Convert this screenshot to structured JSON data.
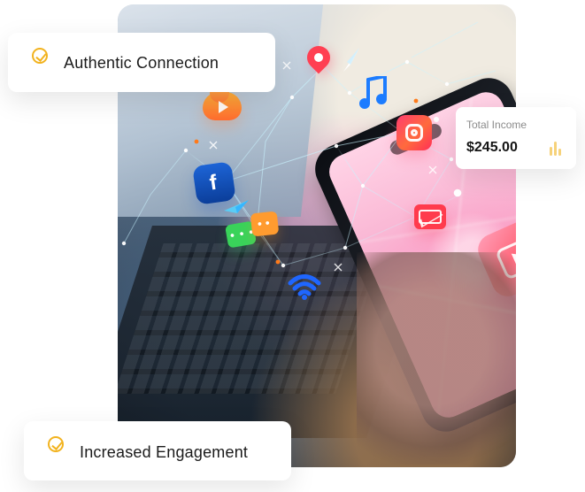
{
  "cards": {
    "authentic_connection": {
      "label": "Authentic Connection"
    },
    "increased_engagement": {
      "label": "Increased Engagement"
    }
  },
  "income_card": {
    "label": "Total Income",
    "value": "$245.00"
  },
  "icons": [
    "location-pin-icon",
    "music-note-icon",
    "instagram-icon",
    "mail-icon",
    "facebook-icon",
    "cloud-play-icon",
    "chat-bubble-icon",
    "wifi-icon",
    "paper-plane-icon",
    "video-app-icon"
  ],
  "colors": {
    "accent_yellow": "#f2b31f",
    "card_text": "#1b1b1b",
    "muted_text": "#8b8b8b"
  },
  "icon_text": {
    "facebook_glyph": "f"
  }
}
